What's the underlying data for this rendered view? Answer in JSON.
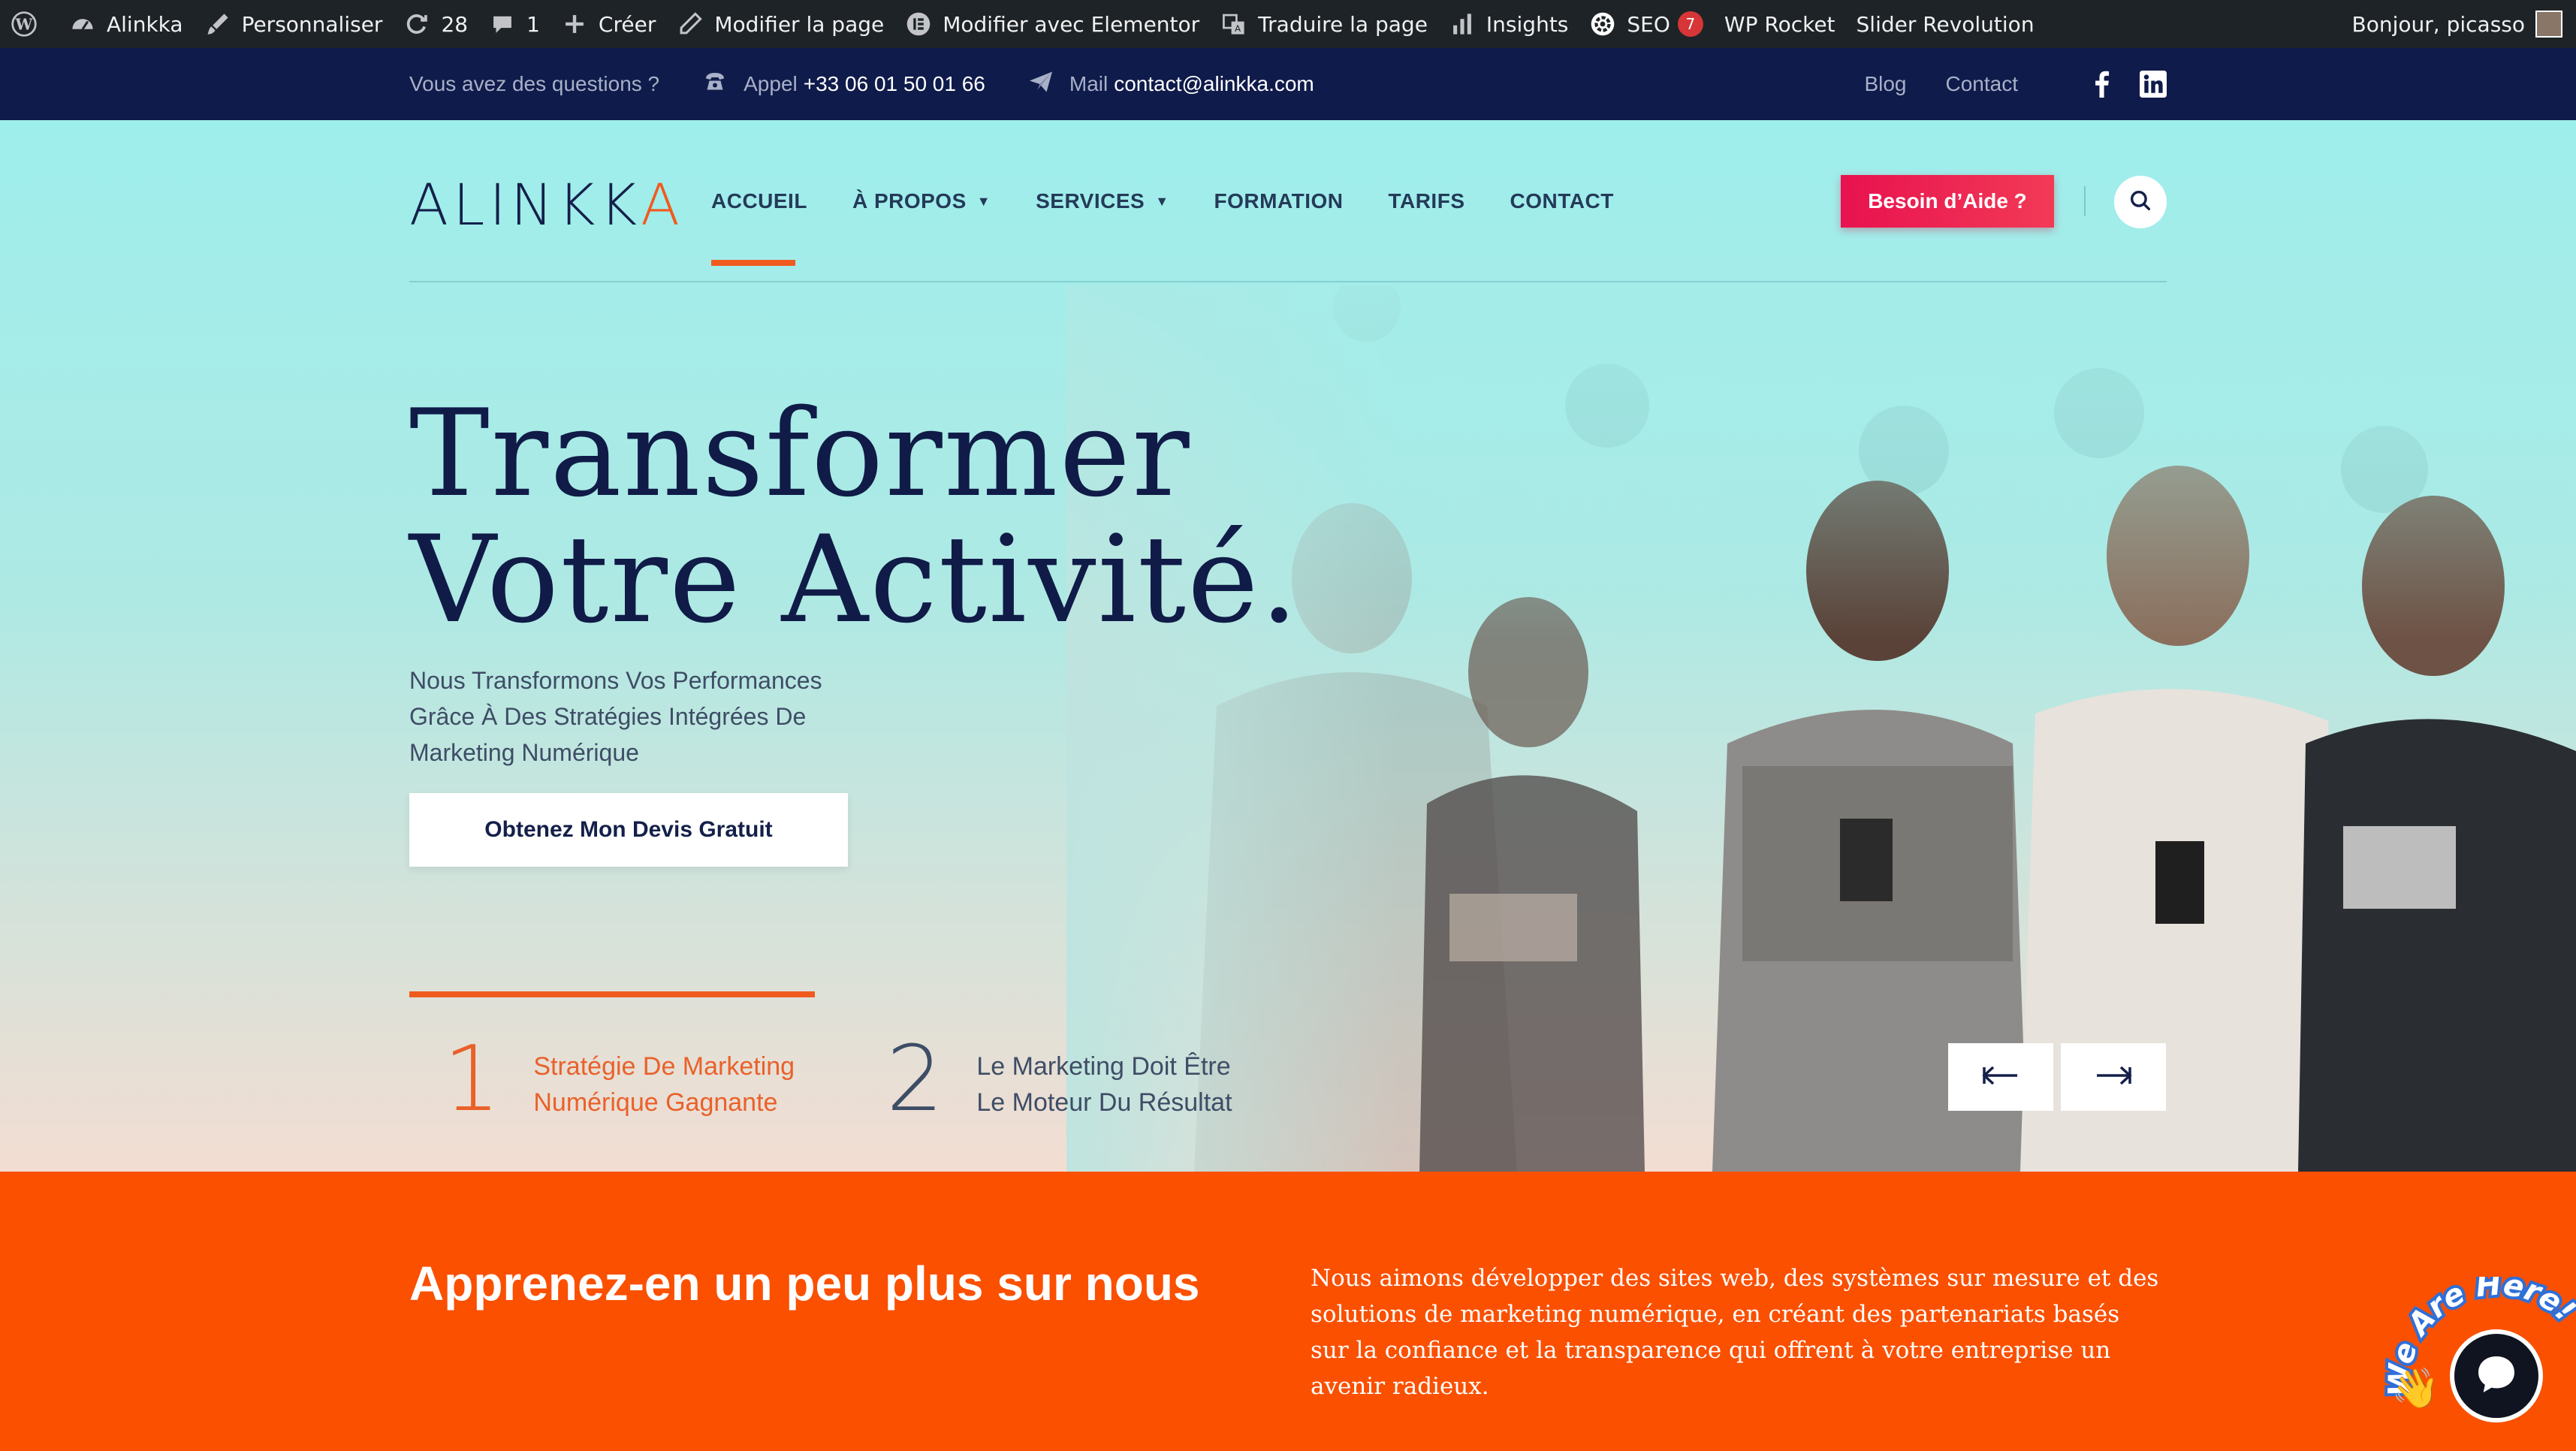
{
  "admin_bar": {
    "site_name": "Alinkka",
    "customize": "Personnaliser",
    "updates_count": "28",
    "comments_count": "1",
    "create": "Créer",
    "edit_page": "Modifier la page",
    "edit_elementor": "Modifier avec Elementor",
    "translate": "Traduire la page",
    "insights": "Insights",
    "seo": "SEO",
    "seo_badge": "7",
    "wp_rocket": "WP Rocket",
    "slider_revolution": "Slider Revolution",
    "greeting": "Bonjour, picasso"
  },
  "info_bar": {
    "question": "Vous avez des questions ?",
    "phone_label": "Appel",
    "phone": "+33 06 01 50 01 66",
    "mail_label": "Mail",
    "mail": "contact@alinkka.com",
    "links": [
      "Blog",
      "Contact"
    ]
  },
  "nav": {
    "logo": {
      "prefix": "ALINKK",
      "accent": "A"
    },
    "items": [
      {
        "label": "ACCUEIL",
        "dropdown": false
      },
      {
        "label": "À PROPOS",
        "dropdown": true
      },
      {
        "label": "SERVICES",
        "dropdown": true
      },
      {
        "label": "FORMATION",
        "dropdown": false
      },
      {
        "label": "TARIFS",
        "dropdown": false
      },
      {
        "label": "CONTACT",
        "dropdown": false
      }
    ],
    "help_button": "Besoin d’Aide ?"
  },
  "hero": {
    "title_line1": "Transformer",
    "title_line2": "Votre Activité.",
    "subtitle": "Nous Transformons Vos Performances Grâce À Des Stratégies Intégrées De Marketing Numérique",
    "cta": "Obtenez Mon Devis Gratuit",
    "slides": [
      {
        "number": "1",
        "line1": "Stratégie De Marketing",
        "line2": "Numérique Gagnante"
      },
      {
        "number": "2",
        "line1": "Le Marketing Doit Être",
        "line2": "Le Moteur Du Résultat"
      }
    ]
  },
  "about": {
    "title": "Apprenez-en un peu plus sur nous",
    "text": "Nous aimons développer des sites web, des systèmes sur mesure et des solutions de marketing numérique, en créant des partenariats basés sur la confiance et la transparence qui offrent à votre entreprise un avenir radieux."
  },
  "chat_widget": {
    "label": "We Are Here!"
  },
  "colors": {
    "accent": "#f05a1e",
    "navy": "#0f1b4a",
    "cta_red": "#e8124f",
    "about_bg": "#fa5000"
  }
}
